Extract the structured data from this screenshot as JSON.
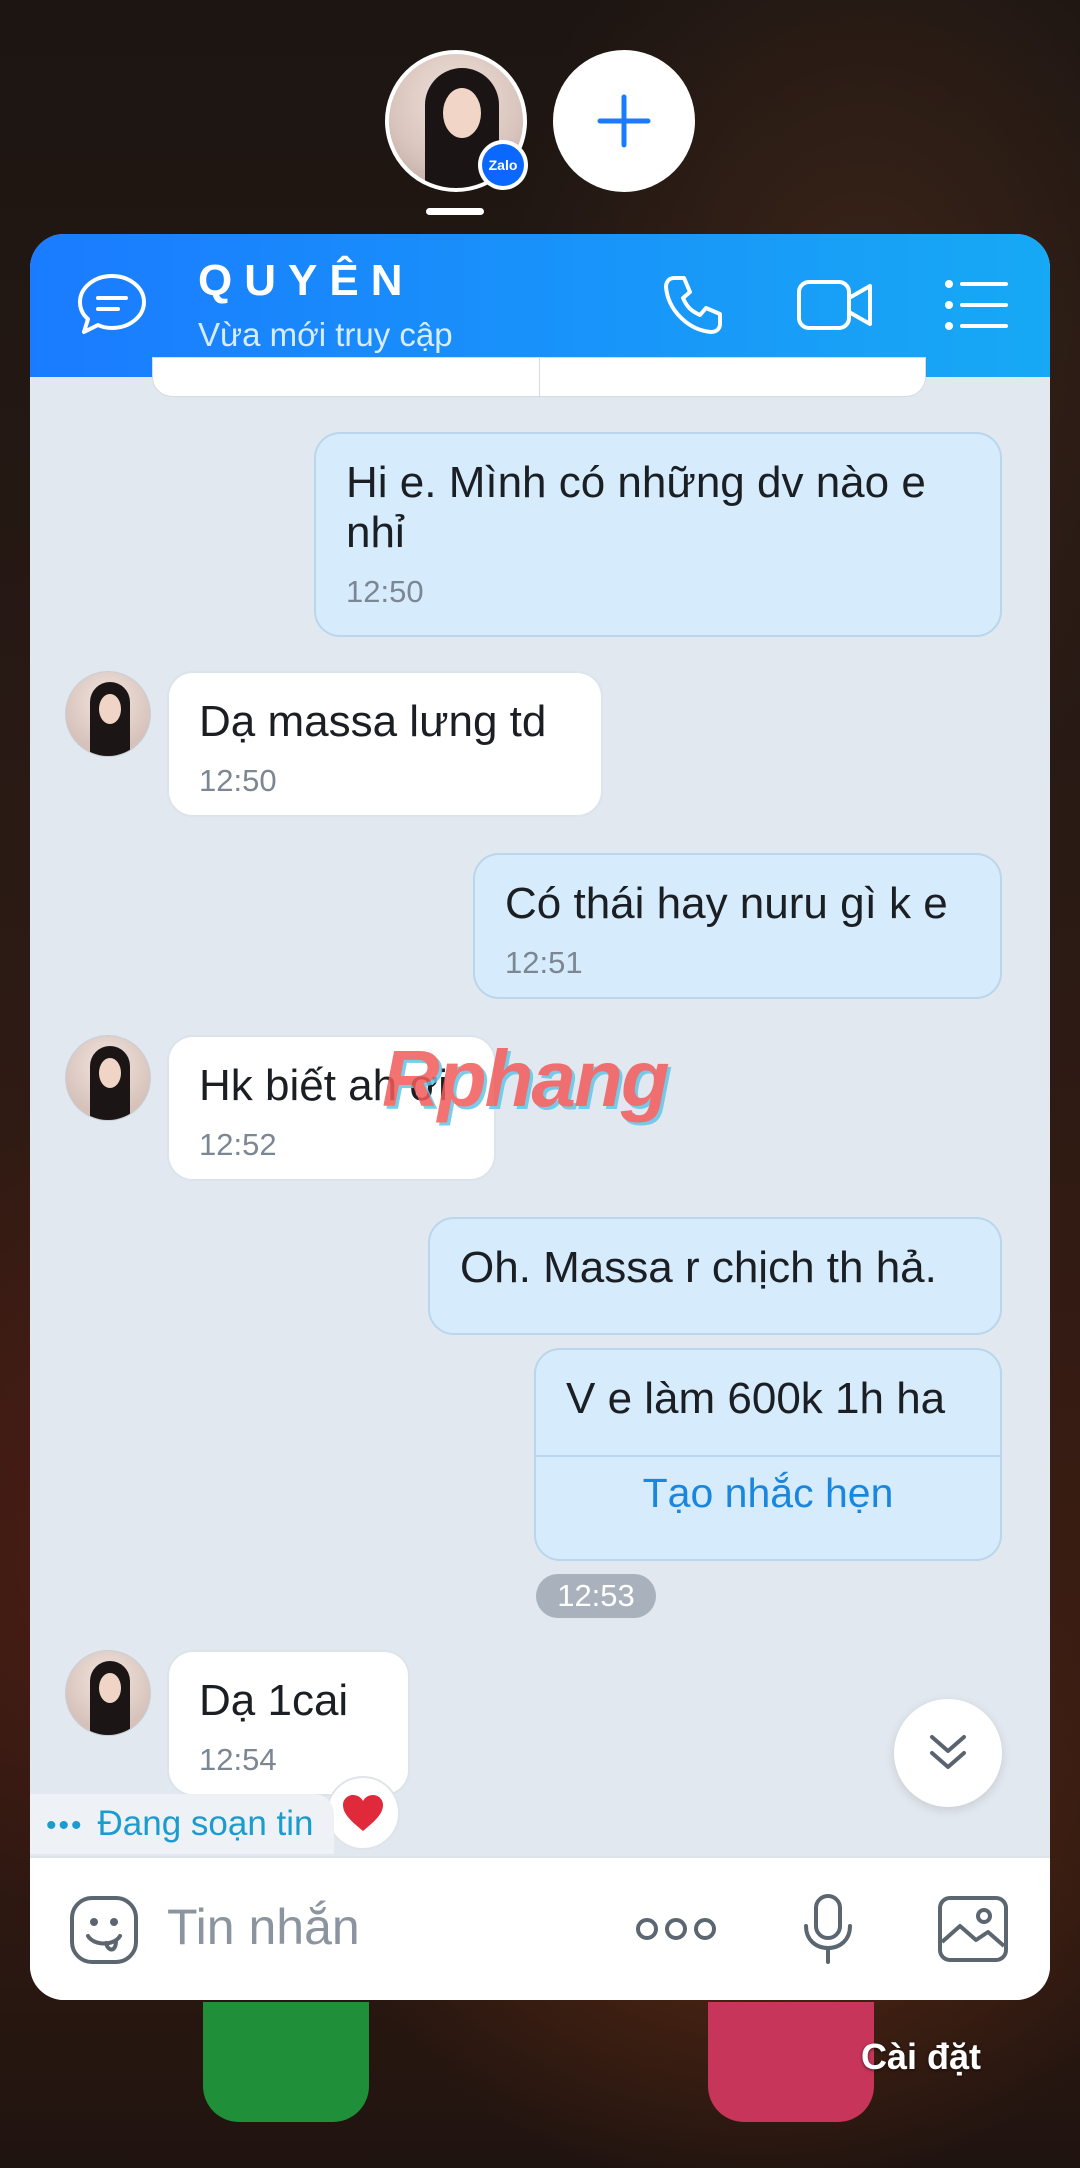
{
  "header": {
    "contact_name": "QUYÊN",
    "status": "Vừa mới truy cập"
  },
  "messages": [
    {
      "direction": "out",
      "text": "Hi e. Mình có những dv nào e nhỉ",
      "time": "12:50"
    },
    {
      "direction": "in",
      "text": "Dạ massa lưng td",
      "time": "12:50"
    },
    {
      "direction": "out",
      "text": "Có thái hay nuru gì k e",
      "time": "12:51"
    },
    {
      "direction": "in",
      "text": "Hk biết ah ơi",
      "time": "12:52"
    },
    {
      "direction": "out",
      "text": "Oh. Massa r chịch th hả.",
      "time": ""
    },
    {
      "direction": "out",
      "text": "V e làm 600k 1h ha",
      "time": "12:53",
      "action": "Tạo nhắc hẹn"
    },
    {
      "direction": "in",
      "text": "Dạ 1cai",
      "time": "12:54"
    }
  ],
  "typing_indicator": "Đang soạn tin",
  "watermark": "Rphang",
  "input": {
    "placeholder": "Tin nhắn"
  },
  "bubble_badge": "Zalo",
  "home_screen": {
    "settings_label": "Cài đặt"
  },
  "colors": {
    "header_start": "#1a7bff",
    "header_end": "#17a9f5",
    "outgoing_bubble": "#d6ecfc",
    "incoming_bubble": "#ffffff",
    "link": "#1a86dd",
    "heart": "#e02a3c"
  },
  "icons": {
    "header": [
      "chat-bubble-icon",
      "phone-icon",
      "video-camera-icon",
      "list-menu-icon"
    ],
    "input": [
      "sticker-icon",
      "more-icon",
      "microphone-icon",
      "image-icon"
    ]
  }
}
